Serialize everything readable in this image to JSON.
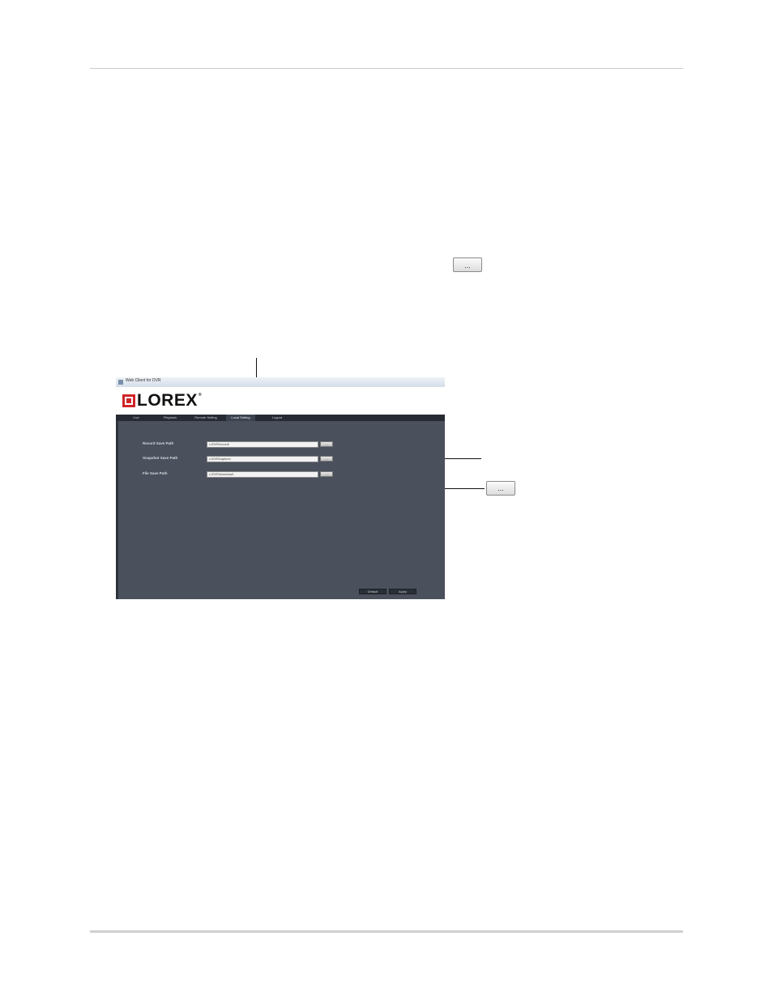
{
  "inline_button": {
    "label": "..."
  },
  "screenshot": {
    "window_title": "Web Client for DVR",
    "logo_text": "LOREX",
    "logo_mark": "®",
    "nav": [
      "Live",
      "Playback",
      "Remote Setting",
      "Local Setting",
      "Logout"
    ],
    "active_nav_index": 3,
    "fields": [
      {
        "label": "Record Save Path",
        "value": "c:\\DVR\\record\\",
        "button": "..."
      },
      {
        "label": "Snapshot Save Path",
        "value": "c:\\DVR\\capture\\",
        "button": "..."
      },
      {
        "label": "File Save Path",
        "value": "c:\\DVR\\download\\",
        "button": "..."
      }
    ],
    "footer_buttons": {
      "default": "Default",
      "apply": "Apply"
    }
  },
  "callout_button": {
    "label": "..."
  },
  "colors": {
    "panel": "#4a505c",
    "navbar": "#262b33",
    "logo_red": "#d0242a"
  }
}
